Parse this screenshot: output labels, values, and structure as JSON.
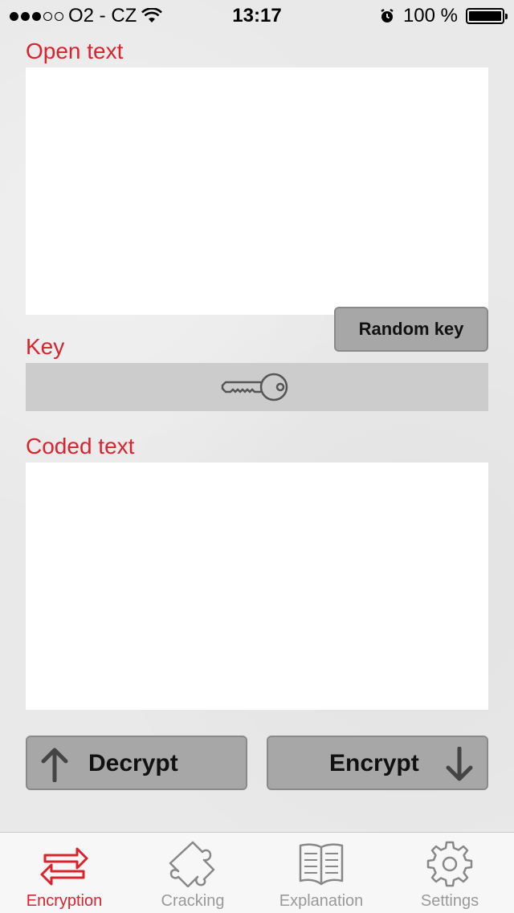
{
  "status_bar": {
    "carrier": "O2 - CZ",
    "time": "13:17",
    "battery": "100 %"
  },
  "open_text": {
    "label": "Open text",
    "value": ""
  },
  "random_key_button": {
    "label": "Random key"
  },
  "key": {
    "label": "Key",
    "icon": "key-icon"
  },
  "coded_text": {
    "label": "Coded text",
    "value": ""
  },
  "actions": {
    "decrypt": "Decrypt",
    "encrypt": "Encrypt"
  },
  "tabs": [
    {
      "label": "Encryption",
      "icon": "encryption-arrows-icon",
      "active": true
    },
    {
      "label": "Cracking",
      "icon": "puzzle-icon",
      "active": false
    },
    {
      "label": "Explanation",
      "icon": "book-icon",
      "active": false
    },
    {
      "label": "Settings",
      "icon": "gear-icon",
      "active": false
    }
  ],
  "colors": {
    "accent": "#d9232e",
    "button": "#a7a7a7",
    "keybar": "#cccccc",
    "inactive_tab": "#999999"
  }
}
